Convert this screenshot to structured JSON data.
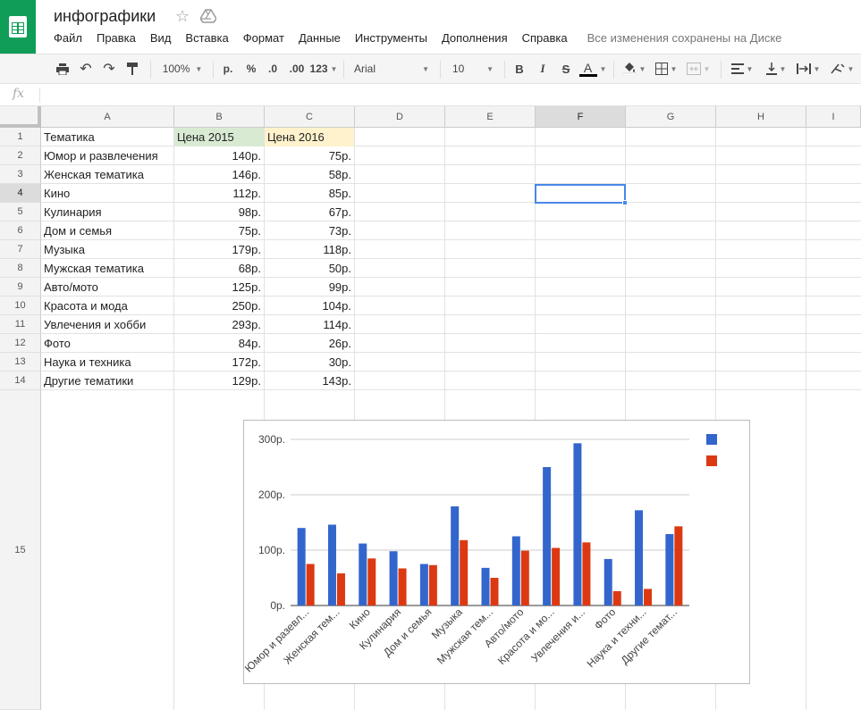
{
  "app": {
    "title": "инфографики",
    "menu": [
      "Файл",
      "Правка",
      "Вид",
      "Вставка",
      "Формат",
      "Данные",
      "Инструменты",
      "Дополнения",
      "Справка"
    ],
    "save_status": "Все изменения сохранены на Диске"
  },
  "toolbar": {
    "zoom": "100%",
    "currency": "р.",
    "percent": "%",
    "dec_decrease": ".0",
    "dec_increase": ".00",
    "more_formats": "123",
    "font": "Arial",
    "font_size": "10",
    "bold": "B",
    "italic": "I",
    "strike": "S",
    "text_color_label": "A"
  },
  "formula_bar": {
    "icon": "fx",
    "value": ""
  },
  "grid": {
    "columns": [
      "A",
      "B",
      "C",
      "D",
      "E",
      "F",
      "G",
      "H",
      "I"
    ],
    "rows": [
      "1",
      "2",
      "3",
      "4",
      "5",
      "6",
      "7",
      "8",
      "9",
      "10",
      "11",
      "12",
      "13",
      "14",
      "15"
    ],
    "active_column": "F",
    "active_row": "4",
    "header_row": [
      "Тематика",
      "Цена 2015",
      "Цена 2016"
    ],
    "data": [
      [
        "Юмор и развлечения",
        "140р.",
        "75р."
      ],
      [
        "Женская тематика",
        "146р.",
        "58р."
      ],
      [
        "Кино",
        "112р.",
        "85р."
      ],
      [
        "Кулинария",
        "98р.",
        "67р."
      ],
      [
        "Дом и семья",
        "75р.",
        "73р."
      ],
      [
        "Музыка",
        "179р.",
        "118р."
      ],
      [
        "Мужская тематика",
        "68р.",
        "50р."
      ],
      [
        "Авто/мото",
        "125р.",
        "99р."
      ],
      [
        "Красота и мода",
        "250р.",
        "104р."
      ],
      [
        "Увлечения и хобби",
        "293р.",
        "114р."
      ],
      [
        "Фото",
        "84р.",
        "26р."
      ],
      [
        "Наука и техника",
        "172р.",
        "30р."
      ],
      [
        "Другие тематики",
        "129р.",
        "143р."
      ]
    ],
    "colors": {
      "b1_fill": "#d9ead3",
      "c1_fill": "#fff2cc",
      "selection": "#4a86e8"
    }
  },
  "chart_data": {
    "type": "bar",
    "categories": [
      "Юмор и разевл...",
      "Женская тем...",
      "Кино",
      "Кулинария",
      "Дом и семья",
      "Музыка",
      "Мужская тем...",
      "Авто/мото",
      "Красота и мо...",
      "Увлечения и...",
      "Фото",
      "Наука и техни...",
      "Другие темат..."
    ],
    "series": [
      {
        "values": [
          140,
          146,
          112,
          98,
          75,
          179,
          68,
          125,
          250,
          293,
          84,
          172,
          129
        ],
        "color": "#3366cc"
      },
      {
        "values": [
          75,
          58,
          85,
          67,
          73,
          118,
          50,
          99,
          104,
          114,
          26,
          30,
          143
        ],
        "color": "#dc3912"
      }
    ],
    "y_ticks": [
      "0р.",
      "100р.",
      "200р.",
      "300р."
    ],
    "ylim": [
      0,
      300
    ],
    "grid": true,
    "legend_position": "top-right"
  }
}
